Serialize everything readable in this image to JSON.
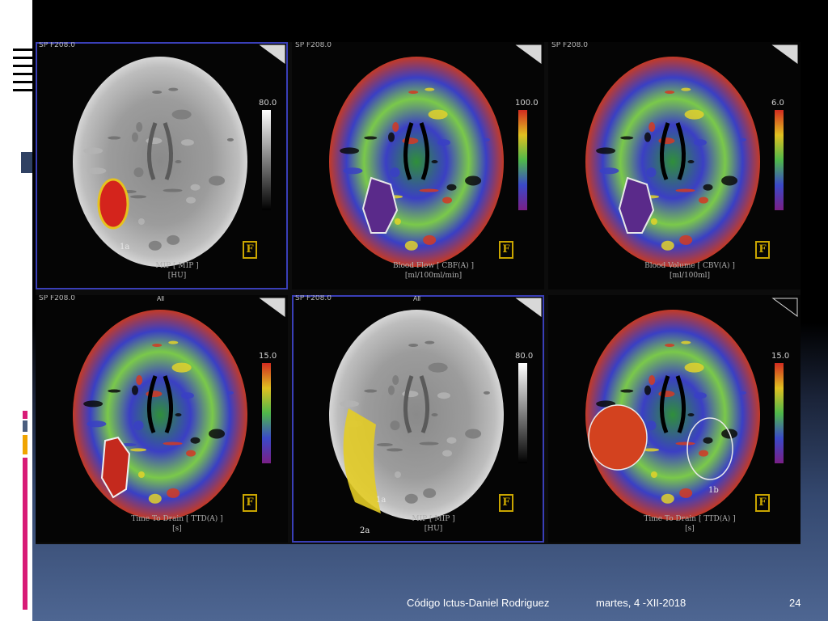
{
  "slide": {
    "footer_left": "Código Ictus-Daniel Rodriguez",
    "footer_date": "martes, 4 -XII-2018",
    "page_number": "24"
  },
  "panels": [
    {
      "header": "SP F208.0",
      "header_right": "",
      "scale_max": "80.0",
      "caption1": "MIP [ MIP ]",
      "caption2": "[HU]",
      "roi": "1a",
      "roi2": "",
      "colormap": "gray"
    },
    {
      "header": "SP F208.0",
      "header_right": "",
      "scale_max": "100.0",
      "caption1": "Blood Flow [ CBF(A) ]",
      "caption2": "[ml/100ml/min]",
      "roi": "",
      "roi2": "",
      "colormap": "rainbow"
    },
    {
      "header": "SP F208.0",
      "header_right": "",
      "scale_max": "6.0",
      "caption1": "Blood Volume [ CBV(A) ]",
      "caption2": "[ml/100ml]",
      "roi": "",
      "roi2": "",
      "colormap": "rainbow"
    },
    {
      "header": "SP F208.0",
      "header_right": "All",
      "scale_max": "15.0",
      "caption1": "Time To Drain [ TTD(A) ]",
      "caption2": "[s]",
      "roi": "",
      "roi2": "",
      "colormap": "rainbow"
    },
    {
      "header": "SP F208.0",
      "header_right": "All",
      "scale_max": "80.0",
      "caption1": "MIP [ MIP ]",
      "caption2": "[HU]",
      "roi": "1a",
      "roi2": "2a",
      "colormap": "gray"
    },
    {
      "header": "",
      "header_right": "",
      "scale_max": "15.0",
      "caption1": "Time To Drain [ TTD(A) ]",
      "caption2": "[s]",
      "roi": "1b",
      "roi2": "",
      "colormap": "rainbow"
    }
  ],
  "colors": {
    "accent_pink": "#d81b77",
    "accent_orange": "#f0a400",
    "accent_slate": "#2f4163",
    "selection_outline": "#3a3fb8",
    "ficon": "#c9a500"
  },
  "icons": [
    "corner-triangle-icon",
    "f-marker-icon"
  ]
}
